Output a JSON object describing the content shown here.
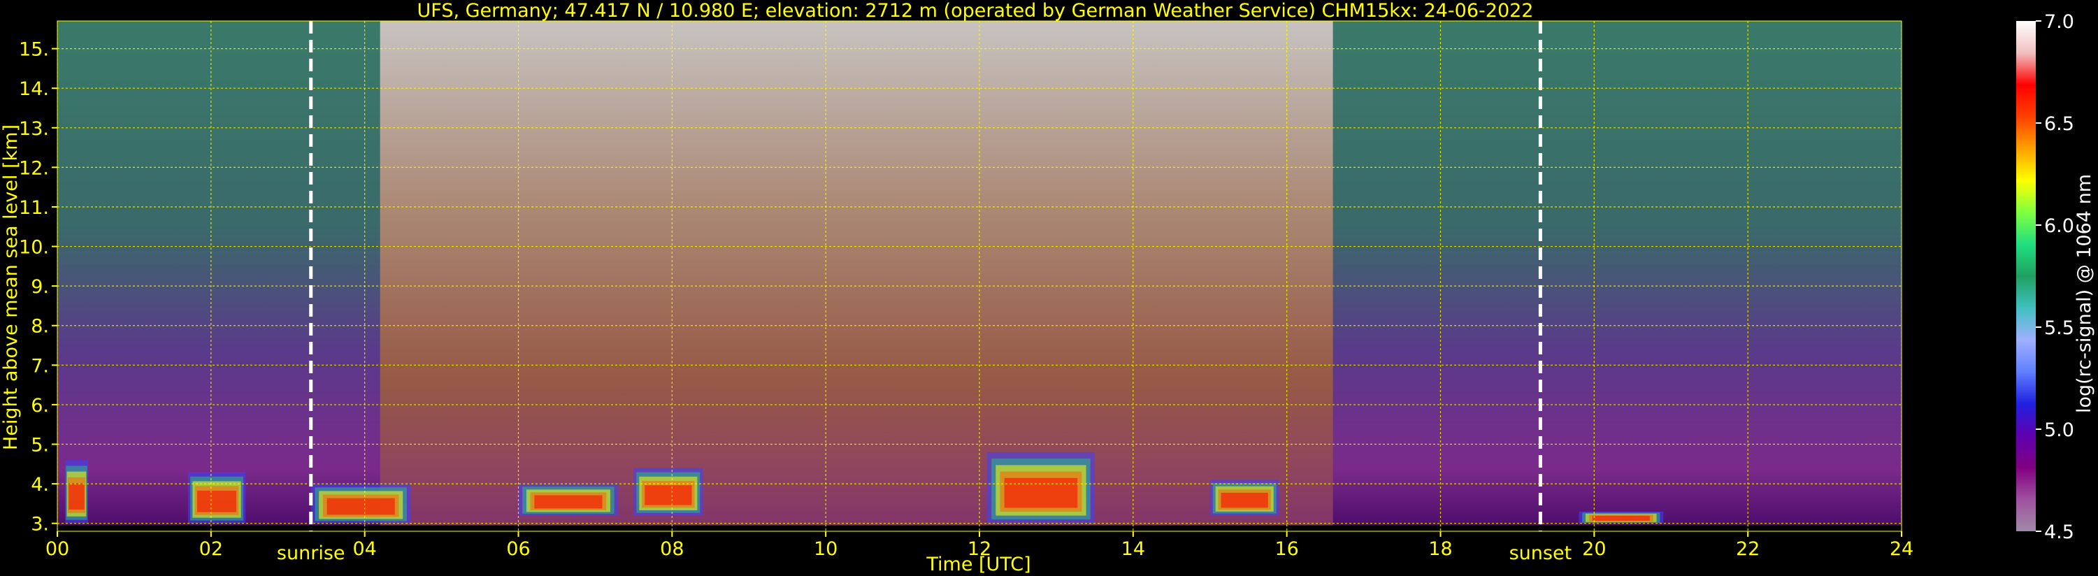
{
  "chart_data": {
    "type": "heatmap",
    "title": "UFS, Germany; 47.417 N / 10.980 E; elevation: 2712 m  (operated by German Weather Service)    CHM15kx: 24-06-2022",
    "xlabel": "Time [UTC]",
    "ylabel": "Height above mean sea level [km]",
    "colorbar_label": "log(rc-signal) @ 1064 nm",
    "xlim": [
      0,
      24
    ],
    "ylim": [
      2.8,
      15.7
    ],
    "x_ticks": [
      0,
      2,
      4,
      6,
      8,
      10,
      12,
      14,
      16,
      18,
      20,
      22,
      24
    ],
    "x_tick_labels": [
      "00",
      "02",
      "04",
      "06",
      "08",
      "10",
      "12",
      "14",
      "16",
      "18",
      "20",
      "22",
      "24"
    ],
    "y_ticks": [
      3,
      4,
      5,
      6,
      7,
      8,
      9,
      10,
      11,
      12,
      13,
      14,
      15
    ],
    "y_tick_labels": [
      "3.",
      "4.",
      "5.",
      "6.",
      "7.",
      "8.",
      "9.",
      "10.",
      "11.",
      "12.",
      "13.",
      "14.",
      "15."
    ],
    "grid": true,
    "colorbar": {
      "range": [
        4.5,
        7.0
      ],
      "ticks": [
        4.5,
        5.0,
        5.5,
        6.0,
        6.5,
        7.0
      ],
      "tick_labels": [
        "4.5",
        "5.0",
        "5.5",
        "6.0",
        "6.5",
        "7.0"
      ]
    },
    "markers": [
      {
        "label": "sunrise",
        "time": 3.3
      },
      {
        "label": "sunset",
        "time": 19.3
      }
    ],
    "cloud_layers": [
      {
        "t_start": 0.1,
        "t_end": 0.4,
        "h_bottom": 3.0,
        "h_top": 4.6
      },
      {
        "t_start": 1.7,
        "t_end": 2.45,
        "h_bottom": 3.0,
        "h_top": 4.3
      },
      {
        "t_start": 3.3,
        "t_end": 4.6,
        "h_bottom": 3.0,
        "h_top": 4.0
      },
      {
        "t_start": 6.0,
        "t_end": 7.3,
        "h_bottom": 3.2,
        "h_top": 4.0
      },
      {
        "t_start": 7.5,
        "t_end": 8.4,
        "h_bottom": 3.2,
        "h_top": 4.4
      },
      {
        "t_start": 12.1,
        "t_end": 13.5,
        "h_bottom": 3.0,
        "h_top": 4.8
      },
      {
        "t_start": 15.0,
        "t_end": 15.9,
        "h_bottom": 3.2,
        "h_top": 4.1
      },
      {
        "t_start": 19.8,
        "t_end": 20.9,
        "h_bottom": 3.0,
        "h_top": 3.3
      }
    ]
  },
  "colors": {
    "background": "#000000",
    "text": "#ffff00",
    "grid": "#ffff00",
    "colorbar_text": "#ffffff",
    "marker_line": "#ffffff",
    "colorbar_stops": [
      "#a08aa8",
      "#a050a0",
      "#800080",
      "#6000b0",
      "#2020e0",
      "#6080ff",
      "#a0b0ff",
      "#40c0c0",
      "#20a060",
      "#20e080",
      "#80ff40",
      "#ffff00",
      "#ffa000",
      "#ff4000",
      "#ff0000",
      "#f0c0c0",
      "#ffffff"
    ]
  }
}
